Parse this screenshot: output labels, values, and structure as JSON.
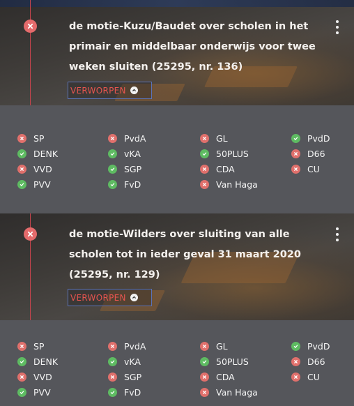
{
  "colors": {
    "against": "#e0706c",
    "for": "#5ebb62",
    "verdict_text": "#e8554f",
    "verdict_border": "#5b73b8",
    "panel_bg": "#55565b"
  },
  "motions": [
    {
      "title": "de motie-Kuzu/Baudet over scholen in het primair en middelbaar onderwijs voor twee weken sluiten (25295, nr. 136)",
      "title_lines": [
        "de motie-Kuzu/Baudet over scholen in het",
        "primair en middelbaar onderwijs voor twee",
        "weken sluiten (25295, nr. 136)"
      ],
      "status_icon": "x-circle-icon",
      "verdict": "VERWORPEN",
      "menu_icon": "kebab-menu-icon",
      "votes": [
        {
          "party": "SP",
          "vote": "against"
        },
        {
          "party": "PvdA",
          "vote": "against"
        },
        {
          "party": "GL",
          "vote": "against"
        },
        {
          "party": "PvdD",
          "vote": "for"
        },
        {
          "party": "DENK",
          "vote": "for"
        },
        {
          "party": "vKA",
          "vote": "for"
        },
        {
          "party": "50PLUS",
          "vote": "for"
        },
        {
          "party": "D66",
          "vote": "against"
        },
        {
          "party": "VVD",
          "vote": "against"
        },
        {
          "party": "SGP",
          "vote": "for"
        },
        {
          "party": "CDA",
          "vote": "against"
        },
        {
          "party": "CU",
          "vote": "against"
        },
        {
          "party": "PVV",
          "vote": "for"
        },
        {
          "party": "FvD",
          "vote": "for"
        },
        {
          "party": "Van Haga",
          "vote": "against"
        }
      ]
    },
    {
      "title": "de motie-Wilders over sluiting van alle scholen tot in ieder geval 31 maart 2020 (25295, nr. 129)",
      "title_lines": [
        "de motie-Wilders over sluiting van alle",
        "scholen tot in ieder geval 31 maart 2020",
        "(25295, nr. 129)"
      ],
      "status_icon": "x-circle-icon",
      "verdict": "VERWORPEN",
      "menu_icon": "kebab-menu-icon",
      "votes": [
        {
          "party": "SP",
          "vote": "against"
        },
        {
          "party": "PvdA",
          "vote": "against"
        },
        {
          "party": "GL",
          "vote": "against"
        },
        {
          "party": "PvdD",
          "vote": "for"
        },
        {
          "party": "DENK",
          "vote": "for"
        },
        {
          "party": "vKA",
          "vote": "for"
        },
        {
          "party": "50PLUS",
          "vote": "for"
        },
        {
          "party": "D66",
          "vote": "against"
        },
        {
          "party": "VVD",
          "vote": "against"
        },
        {
          "party": "SGP",
          "vote": "against"
        },
        {
          "party": "CDA",
          "vote": "against"
        },
        {
          "party": "CU",
          "vote": "against"
        },
        {
          "party": "PVV",
          "vote": "for"
        },
        {
          "party": "FvD",
          "vote": "for"
        },
        {
          "party": "Van Haga",
          "vote": "against"
        }
      ]
    }
  ]
}
